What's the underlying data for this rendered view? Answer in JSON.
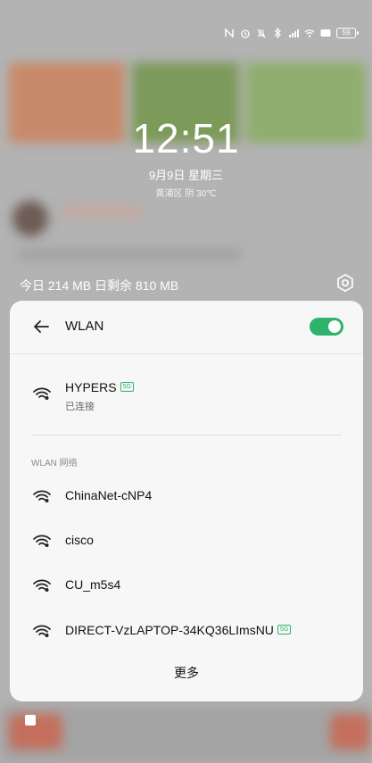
{
  "status_bar": {
    "battery": "59",
    "icons": [
      "nfc-icon",
      "alarm-icon",
      "mute-icon",
      "bluetooth-icon",
      "signal-icon",
      "wifi-icon",
      "hd-icon"
    ]
  },
  "lockscreen": {
    "time": "12:51",
    "date": "9月9日  星期三",
    "weather": "黄浦区 阴 30℃"
  },
  "data_usage": {
    "text": "今日 214 MB 日剩余 810 MB"
  },
  "wlan_panel": {
    "title": "WLAN",
    "toggle_on": true,
    "accent_color": "#2fb36a",
    "connected": {
      "name": "HYPERS",
      "badge": "5G",
      "status": "已连接"
    },
    "section_label": "WLAN 网络",
    "networks": [
      {
        "name": "ChinaNet-cNP4",
        "badge": ""
      },
      {
        "name": "cisco",
        "badge": ""
      },
      {
        "name": "CU_m5s4",
        "badge": ""
      },
      {
        "name": "DIRECT-VzLAPTOP-34KQ36LImsNU",
        "badge": "5G"
      }
    ],
    "more_label": "更多"
  }
}
